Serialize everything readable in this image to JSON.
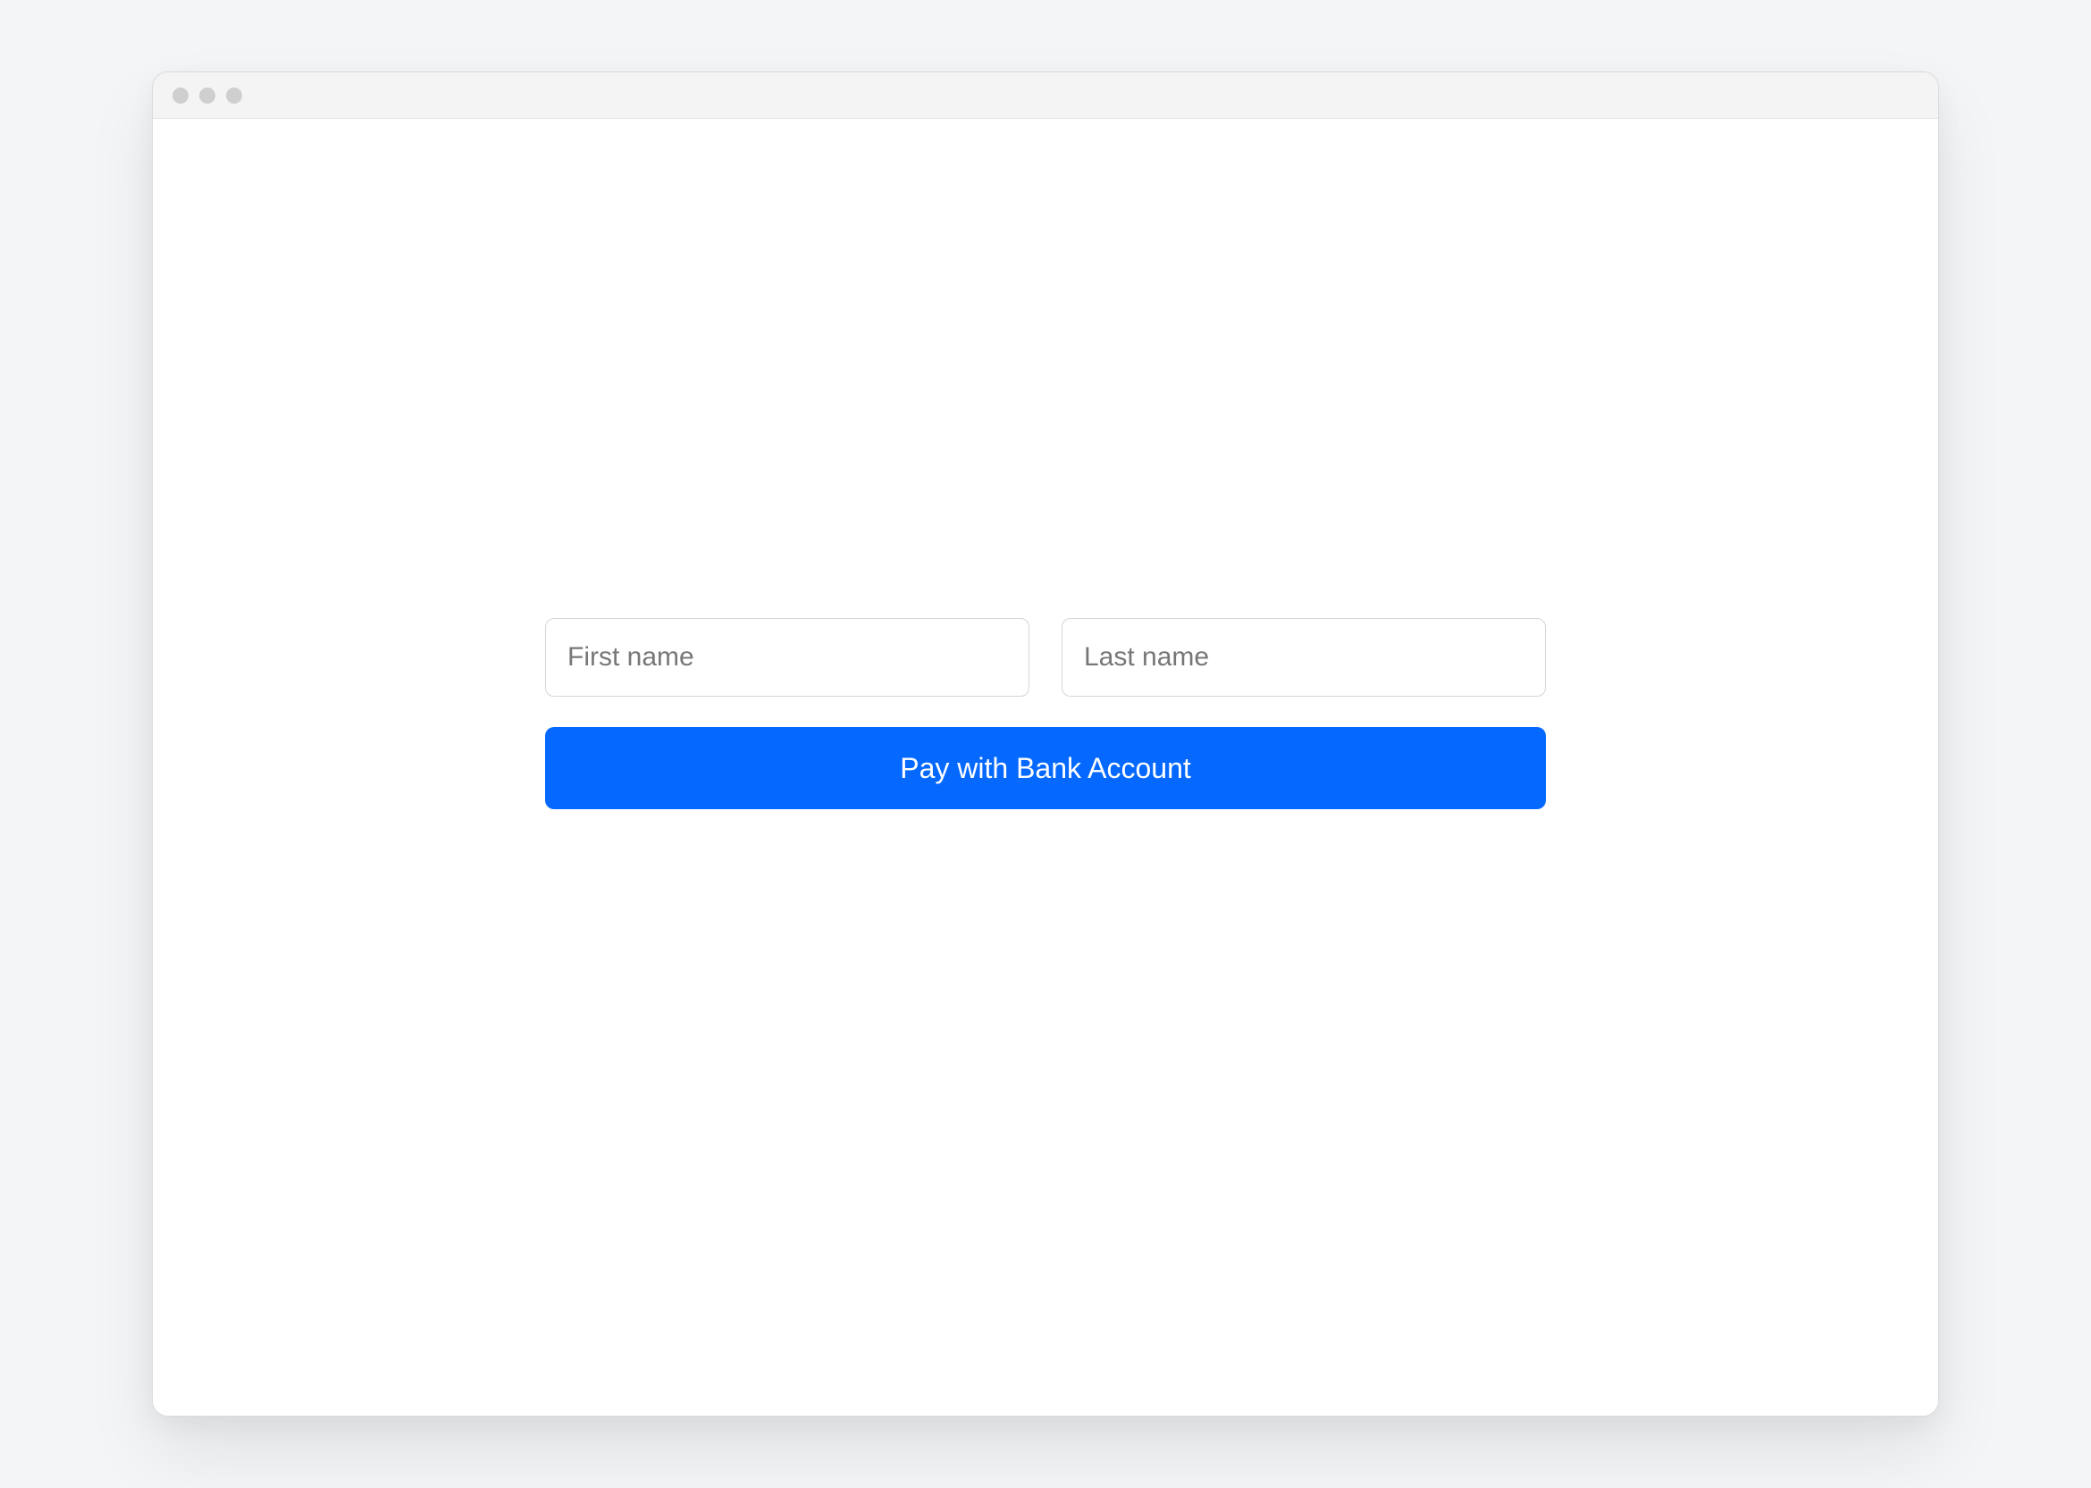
{
  "form": {
    "first_name_placeholder": "First name",
    "first_name_value": "",
    "last_name_placeholder": "Last name",
    "last_name_value": "",
    "submit_label": "Pay with Bank Account"
  },
  "colors": {
    "page_background": "#f3f5f7",
    "window_background": "#ffffff",
    "titlebar_background": "#f4f4f4",
    "dot": "#cfcfcf",
    "input_border": "#d6d6d6",
    "placeholder": "#777777",
    "button_background": "#0569ff",
    "button_text": "#ffffff"
  }
}
